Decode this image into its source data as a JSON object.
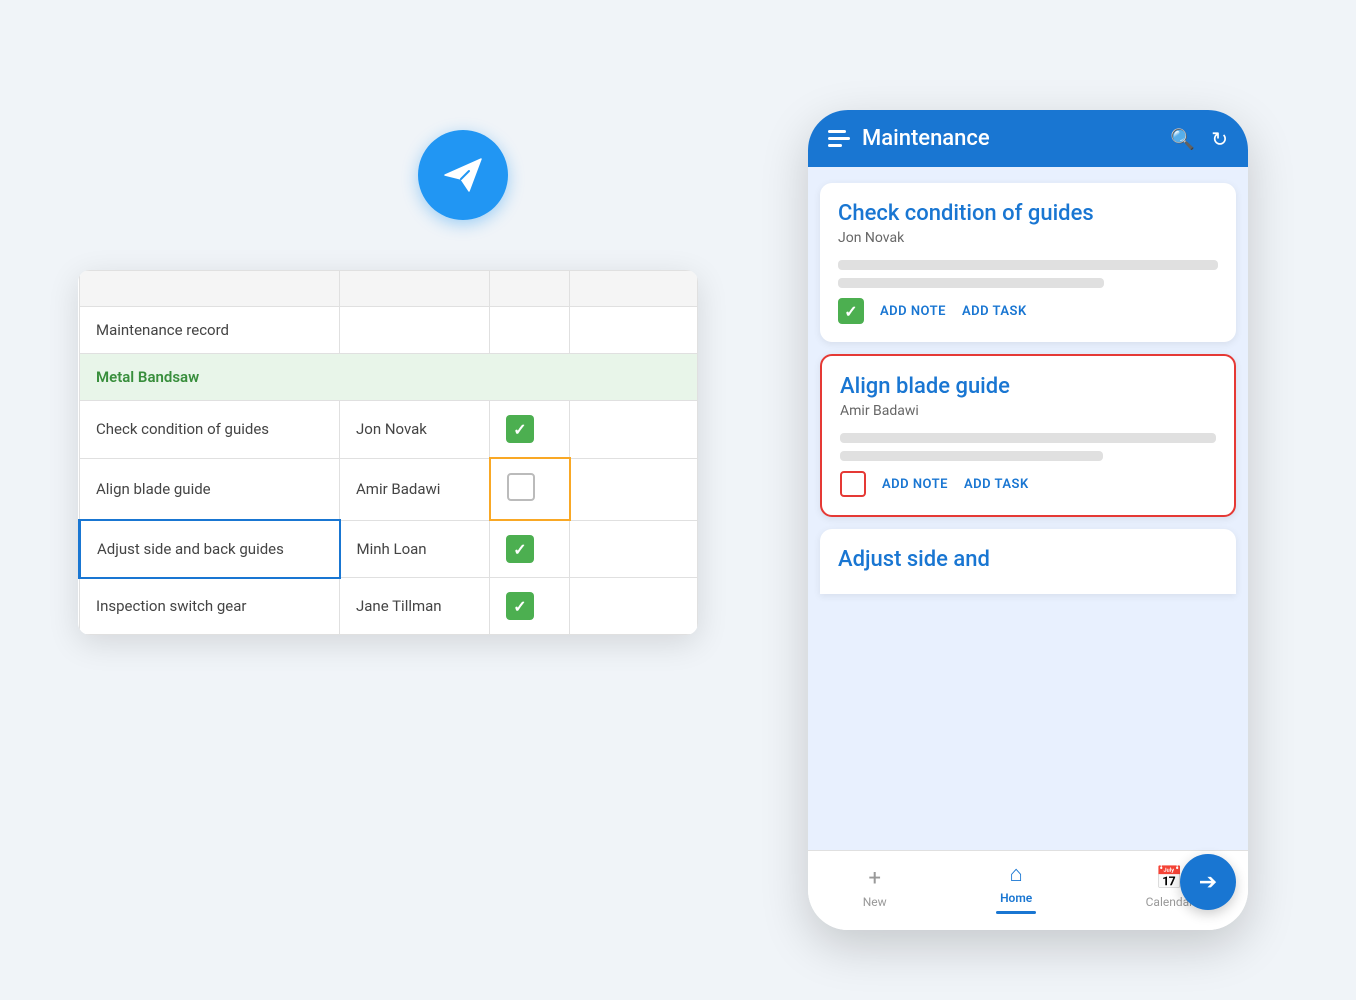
{
  "app": {
    "title": "Maintenance"
  },
  "plane_icon": "✈",
  "spreadsheet": {
    "section": "Metal Bandsaw",
    "maintenance_record": "Maintenance record",
    "rows": [
      {
        "task": "Check condition of guides",
        "person": "Jon Novak",
        "checked": true,
        "selected": false,
        "empty_check": false
      },
      {
        "task": "Align blade guide",
        "person": "Amir Badawi",
        "checked": false,
        "selected": false,
        "empty_check": true
      },
      {
        "task": "Adjust side and back guides",
        "person": "Minh Loan",
        "checked": true,
        "selected": true,
        "empty_check": false
      },
      {
        "task": "Inspection switch gear",
        "person": "Jane Tillman",
        "checked": true,
        "selected": false,
        "empty_check": false
      }
    ]
  },
  "mobile": {
    "topbar": {
      "title": "Maintenance",
      "search_icon": "🔍",
      "refresh_icon": "↻"
    },
    "cards": [
      {
        "id": "card1",
        "title": "Check condition of guides",
        "person": "Jon Novak",
        "checked": true,
        "selected": false,
        "add_note": "ADD NOTE",
        "add_task": "ADD TASK"
      },
      {
        "id": "card2",
        "title": "Align blade guide",
        "person": "Amir Badawi",
        "checked": false,
        "selected": true,
        "add_note": "ADD NOTE",
        "add_task": "ADD TASK"
      }
    ],
    "partial_card_title": "Adjust side and",
    "bottom_nav": {
      "new_label": "New",
      "home_label": "Home",
      "calendar_label": "Calendar"
    }
  }
}
